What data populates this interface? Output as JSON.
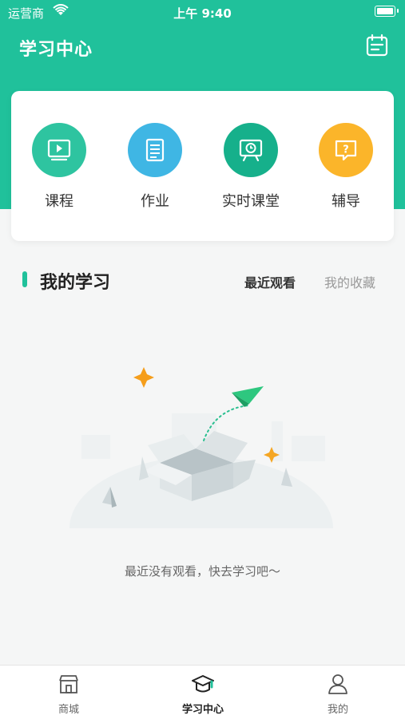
{
  "status_bar": {
    "carrier": "运营商",
    "time": "上午 9:40"
  },
  "header": {
    "title": "学习中心",
    "calendar_icon": "calendar-icon"
  },
  "categories": [
    {
      "label": "课程",
      "icon": "video-icon",
      "color": "#2ec4a0"
    },
    {
      "label": "作业",
      "icon": "document-icon",
      "color": "#3fb6e4"
    },
    {
      "label": "实时课堂",
      "icon": "live-screen-icon",
      "color": "#16b08b"
    },
    {
      "label": "辅导",
      "icon": "question-chat-icon",
      "color": "#fbb52a"
    }
  ],
  "my_study": {
    "title": "我的学习",
    "tabs": {
      "recent": "最近观看",
      "favorites": "我的收藏"
    },
    "active_tab": "recent",
    "empty_text": "最近没有观看，快去学习吧～"
  },
  "tabbar": {
    "items": [
      {
        "label": "商城",
        "icon": "store-icon"
      },
      {
        "label": "学习中心",
        "icon": "graduation-cap-icon"
      },
      {
        "label": "我的",
        "icon": "user-icon"
      }
    ],
    "active": 1
  },
  "colors": {
    "accent": "#20c19b",
    "background": "#f5f6f6"
  }
}
